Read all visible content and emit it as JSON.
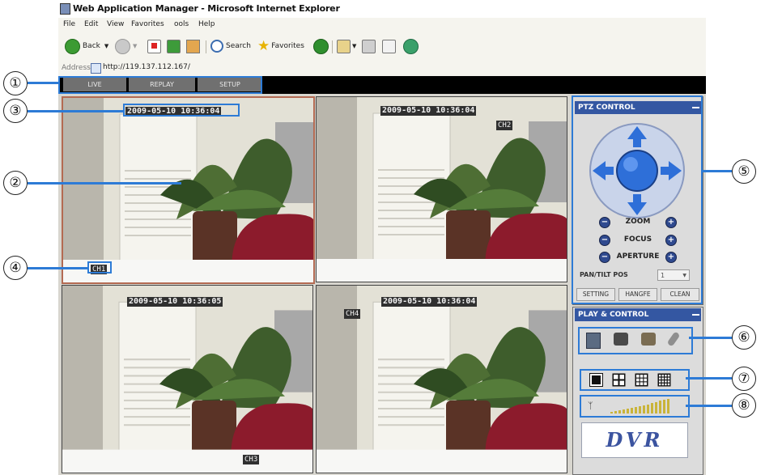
{
  "window": {
    "title": "Web Application Manager - Microsoft Internet Explorer"
  },
  "menu": [
    "File",
    "Edit",
    "View",
    "Favorites",
    "ools",
    "Help"
  ],
  "toolbar": {
    "back": "Back",
    "search": "Search",
    "favorites": "Favorites"
  },
  "address": {
    "label": "Address",
    "url": "http://119.137.112.167/"
  },
  "tabs": [
    "LIVE",
    "REPLAY",
    "SETUP"
  ],
  "cameras": [
    {
      "timestamp": "2009-05-10 10:36:04",
      "label": "CH1"
    },
    {
      "timestamp": "2009-05-10 10:36:04",
      "label": "CH2"
    },
    {
      "timestamp": "2009-05-10 10:36:05",
      "label": "CH3"
    },
    {
      "timestamp": "2009-05-10 10:36:04",
      "label": "CH4"
    }
  ],
  "ptz": {
    "title": "PTZ CONTROL",
    "zoom": "ZOOM",
    "focus": "FOCUS",
    "aperture": "APERTURE",
    "pos_label": "PAN/TILT POS",
    "pos_value": "1",
    "setting": "SETTING",
    "change": "HANGFE",
    "clean": "CLEAN"
  },
  "play": {
    "title": "PLAY & CONTROL",
    "logo": "DVR"
  },
  "callouts": [
    "①",
    "②",
    "③",
    "④",
    "⑤",
    "⑥",
    "⑦",
    "⑧"
  ],
  "colors": {
    "accent": "#2d7bd6",
    "panel_header": "#3457a2",
    "nav_bg": "#000000",
    "active_border": "#b36a52"
  },
  "icons": [
    "back-icon",
    "forward-icon",
    "stop-icon",
    "refresh-icon",
    "home-icon",
    "search-icon",
    "favorites-icon",
    "history-icon",
    "mail-icon",
    "print-icon",
    "edit-icon",
    "messenger-icon"
  ]
}
